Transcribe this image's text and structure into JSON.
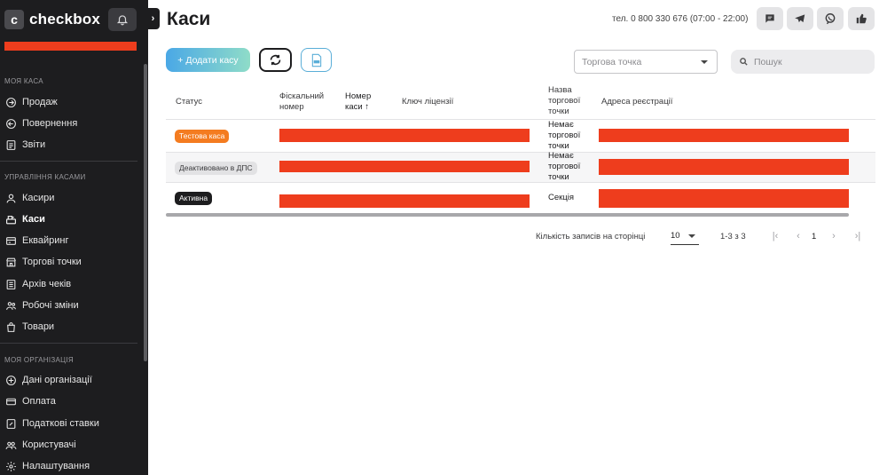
{
  "brand": {
    "logo_letter": "c",
    "name": "checkbox"
  },
  "sidebar": {
    "sections": [
      {
        "title": "МОЯ КАСА",
        "items": [
          {
            "label": "Продаж",
            "icon": "arrow-right-circle-icon"
          },
          {
            "label": "Повернення",
            "icon": "arrow-left-circle-icon"
          },
          {
            "label": "Звіти",
            "icon": "report-icon"
          }
        ]
      },
      {
        "title": "УПРАВЛІННЯ КАСАМИ",
        "items": [
          {
            "label": "Касири",
            "icon": "cashier-icon"
          },
          {
            "label": "Каси",
            "icon": "cash-register-icon",
            "active": true
          },
          {
            "label": "Еквайринг",
            "icon": "card-terminal-icon"
          },
          {
            "label": "Торгові точки",
            "icon": "store-icon"
          },
          {
            "label": "Архів чеків",
            "icon": "archive-icon"
          },
          {
            "label": "Робочі зміни",
            "icon": "shifts-icon"
          },
          {
            "label": "Товари",
            "icon": "bag-icon"
          }
        ]
      },
      {
        "title": "МОЯ ОРГАНІЗАЦІЯ",
        "items": [
          {
            "label": "Дані організації",
            "icon": "organization-icon"
          },
          {
            "label": "Оплата",
            "icon": "payment-icon"
          },
          {
            "label": "Податкові ставки",
            "icon": "tax-icon"
          },
          {
            "label": "Користувачі",
            "icon": "users-icon"
          },
          {
            "label": "Налаштування",
            "icon": "settings-icon"
          }
        ]
      }
    ]
  },
  "header": {
    "title": "Каси",
    "phone": "тел. 0 800 330 676 (07:00 - 22:00)",
    "social": [
      "chat-icon",
      "telegram-icon",
      "viber-icon",
      "like-icon"
    ]
  },
  "toolbar": {
    "add_label": "+ Додати касу",
    "store_select_placeholder": "Торгова точка",
    "search_placeholder": "Пошук"
  },
  "table": {
    "columns": [
      {
        "label": "Статус"
      },
      {
        "label": "Фіскальний номер"
      },
      {
        "label": "Номер каси ↑"
      },
      {
        "label": "Ключ ліцензії"
      },
      {
        "label": "Назва торгової точки"
      },
      {
        "label": "Адреса реєстрації"
      }
    ],
    "rows": [
      {
        "status": "Тестова каса",
        "status_color": "#f47c20",
        "store": "Немає торгової точки"
      },
      {
        "status": "Деактивовано в ДПС",
        "status_color": "#e2e2e4",
        "store": "Немає торгової точки"
      },
      {
        "status": "Активна",
        "status_color": "#1d1d1f",
        "store": "Секція"
      }
    ]
  },
  "pagination": {
    "rows_per_page_label": "Кількість записів на сторінці",
    "rows_per_page": "10",
    "range": "1-3 з 3",
    "page": "1"
  },
  "colors": {
    "redaction": "#ee3d1d",
    "sidebar_bg": "#1d1d1f",
    "accent_blue": "#4aa8e6"
  }
}
